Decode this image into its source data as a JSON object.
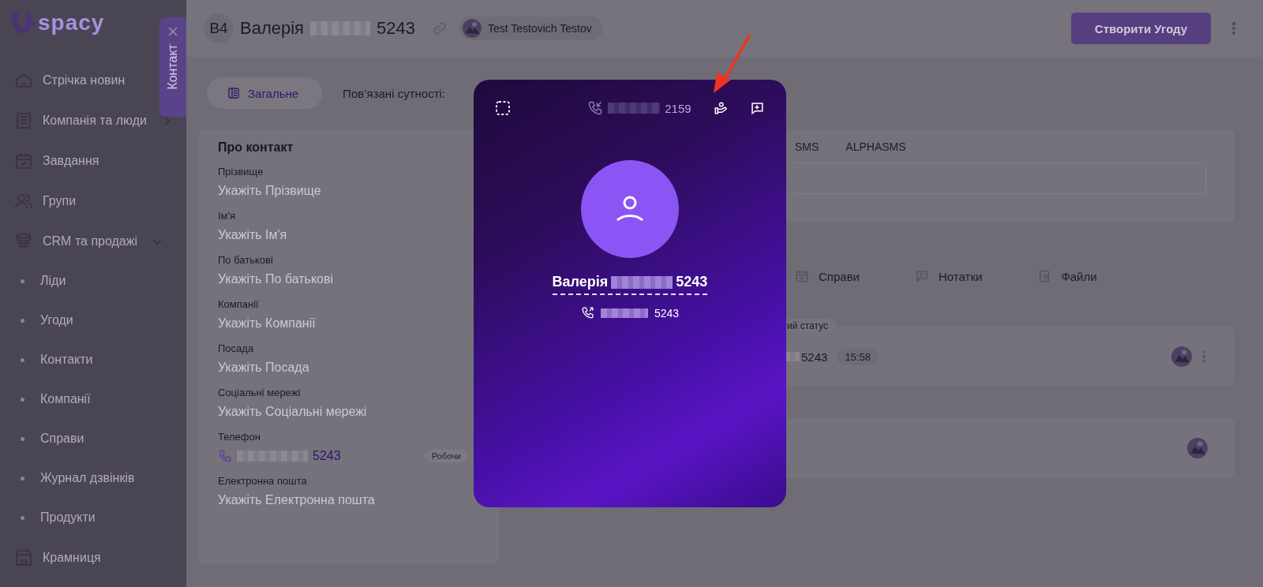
{
  "sidebar": {
    "logo": "spacy",
    "items": [
      {
        "label": "Стрічка новин",
        "kind": "link"
      },
      {
        "label": "Компанія та люди",
        "kind": "group",
        "expanded": false
      },
      {
        "label": "Завдання",
        "kind": "link"
      },
      {
        "label": "Групи",
        "kind": "link"
      },
      {
        "label": "CRM та продажі",
        "kind": "group",
        "expanded": true,
        "children": [
          {
            "label": "Ліди"
          },
          {
            "label": "Угоди"
          },
          {
            "label": "Контакти"
          },
          {
            "label": "Компанії"
          },
          {
            "label": "Справи"
          },
          {
            "label": "Журнал дзвінків"
          },
          {
            "label": "Продукти"
          }
        ]
      },
      {
        "label": "Крамниця",
        "kind": "link"
      }
    ]
  },
  "side_tab": {
    "label": "Контакт"
  },
  "header": {
    "badge": "В4",
    "title_first": "Валерія",
    "title_last": "5243",
    "user": "Test Testovich Testov",
    "create_button": "Створити Угоду"
  },
  "tabs": [
    {
      "label": "Загальне",
      "selected": true
    }
  ],
  "related_label": "Пов’язані сутності:",
  "contact": {
    "title": "Про контакт",
    "fields": [
      {
        "kind": "text",
        "label": "Прізвище",
        "placeholder": "Укажіть Прізвище"
      },
      {
        "kind": "text",
        "label": "Ім'я",
        "placeholder": "Укажіть Ім'я"
      },
      {
        "kind": "text",
        "label": "По батькові",
        "placeholder": "Укажіть По батькові"
      },
      {
        "kind": "text",
        "label": "Компанії",
        "placeholder": "Укажіть Компанії"
      },
      {
        "kind": "text",
        "label": "Посада",
        "placeholder": "Укажіть Посада"
      },
      {
        "kind": "text",
        "label": "Соціальні мережі",
        "placeholder": "Укажіть Соціальні мережі"
      },
      {
        "kind": "phone",
        "label": "Телефон",
        "value": "5243",
        "tag": "Робочи"
      },
      {
        "kind": "text",
        "label": "Електронна пошта",
        "placeholder": "Укажіть Електронна пошта"
      }
    ]
  },
  "messaging": {
    "tabs": [
      {
        "label": "SMS",
        "selected": false
      },
      {
        "label": "ALPHASMS",
        "selected": false
      }
    ]
  },
  "activity_tabs": [
    {
      "label": "Справи"
    },
    {
      "label": "Нотатки"
    },
    {
      "label": "Файли"
    }
  ],
  "feed": [
    {
      "kind": "call",
      "status": "ий статус",
      "number": "5243",
      "time": "15:58"
    },
    {
      "kind": "entry"
    }
  ],
  "call": {
    "number": "2159",
    "name_first": "Валерія",
    "name_last": "5243",
    "phone": "5243"
  }
}
